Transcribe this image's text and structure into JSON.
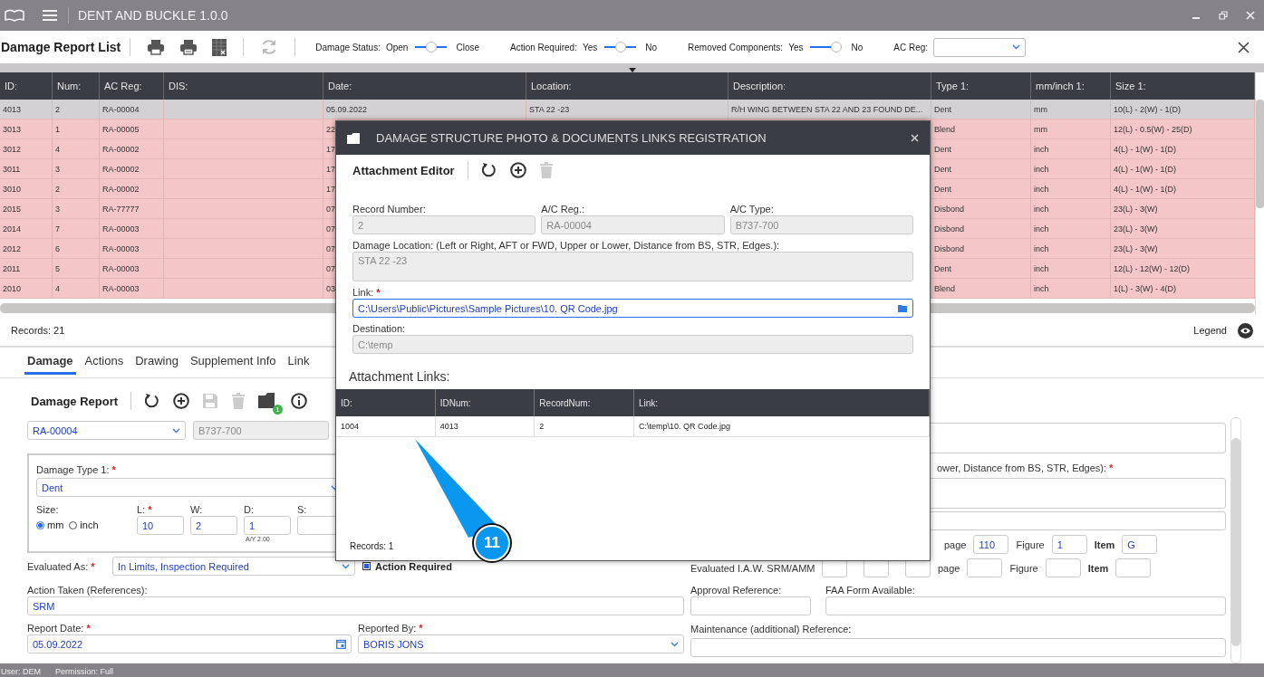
{
  "window": {
    "title": "DENT AND BUCKLE 1.0.0"
  },
  "toolbar": {
    "title": "Damage Report List",
    "filters": [
      {
        "label": "Damage Status:",
        "left": "Open",
        "right": "Close",
        "level": 0.5
      },
      {
        "label": "Action Required:",
        "left": "Yes",
        "right": "No",
        "level": 0.5
      },
      {
        "label": "Removed Components:",
        "left": "Yes",
        "right": "No",
        "level": 1
      }
    ],
    "ac_reg": {
      "label": "AC Reg:"
    }
  },
  "table": {
    "columns": [
      "ID:",
      "Num:",
      "AC Reg:",
      "DIS:",
      "Date:",
      "Location:",
      "Description:",
      "Type 1:",
      "mm/inch 1:",
      "Size 1:"
    ],
    "rows": [
      {
        "selected": true,
        "cells": [
          "4013",
          "2",
          "RA-00004",
          null,
          "05.09.2022",
          "STA 22 -23",
          "R/H WING BETWEEN STA 22 AND 23 FOUND DE...",
          "Dent",
          "mm",
          "10(L) - 2(W) - 1(D)"
        ]
      },
      {
        "selected": false,
        "cells": [
          "3013",
          "1",
          "RA-00005",
          null,
          "22",
          null,
          null,
          "Blend",
          "mm",
          "12(L) - 0.5(W) - 25(D)"
        ]
      },
      {
        "selected": false,
        "cells": [
          "3012",
          "4",
          "RA-00002",
          null,
          "17",
          null,
          null,
          "Dent",
          "inch",
          "4(L) - 1(W) - 1(D)"
        ]
      },
      {
        "selected": false,
        "cells": [
          "3011",
          "3",
          "RA-00002",
          null,
          "17",
          null,
          null,
          "Dent",
          "inch",
          "4(L) - 1(W) - 1(D)"
        ]
      },
      {
        "selected": false,
        "cells": [
          "3010",
          "2",
          "RA-00002",
          null,
          "17",
          null,
          null,
          "Dent",
          "inch",
          "4(L) - 1(W) - 1(D)"
        ]
      },
      {
        "selected": false,
        "cells": [
          "2015",
          "3",
          "RA-77777",
          null,
          "07",
          null,
          null,
          "Disbond",
          "inch",
          "23(L) - 3(W)"
        ]
      },
      {
        "selected": false,
        "cells": [
          "2014",
          "7",
          "RA-00003",
          null,
          "07",
          null,
          null,
          "Disbond",
          "inch",
          "23(L) - 3(W)"
        ]
      },
      {
        "selected": false,
        "cells": [
          "2012",
          "6",
          "RA-00003",
          null,
          "07",
          null,
          null,
          "Disbond",
          "inch",
          "23(L) - 3(W)"
        ]
      },
      {
        "selected": false,
        "cells": [
          "2011",
          "5",
          "RA-00003",
          null,
          "07",
          null,
          null,
          "Dent",
          "inch",
          "12(L) - 12(W) - 12(D)"
        ]
      },
      {
        "selected": false,
        "cells": [
          "2010",
          "4",
          "RA-00003",
          null,
          "03",
          null,
          null,
          "Blend",
          "inch",
          "1(L) - 3(W) - 4(D)"
        ]
      }
    ]
  },
  "records": "Records: 21",
  "legend": "Legend",
  "tabs": [
    {
      "label": "Damage",
      "selected": true
    },
    {
      "label": "Actions",
      "selected": false
    },
    {
      "label": "Drawing",
      "selected": false
    },
    {
      "label": "Supplement Info",
      "selected": false
    },
    {
      "label": "Link",
      "selected": false
    }
  ],
  "form": {
    "title": "Damage Report",
    "attachment_count": "1",
    "ac_reg": {
      "value": "RA-00004"
    },
    "ac_type": {
      "value": "B737-700",
      "disabled": true
    },
    "damage_type": {
      "label": "Damage Type 1:",
      "mark": "*",
      "value": "Dent"
    },
    "size": {
      "label": "Size:",
      "options": [
        {
          "label": "mm",
          "selected": true
        },
        {
          "label": "inch",
          "selected": false
        }
      ]
    },
    "dims": [
      {
        "label": "L:",
        "mark": "*",
        "value": "10"
      },
      {
        "label": "W:",
        "value": "2"
      },
      {
        "label": "D:",
        "value": "1",
        "note": "A/Y 2.00"
      },
      {
        "label": "S:"
      }
    ],
    "evaluated_as": {
      "label": "Evaluated As:",
      "mark": "*",
      "value": "In Limits, Inspection Required"
    },
    "action_required": {
      "label": "Action Required",
      "checked": true
    },
    "action_taken": {
      "label": "Action Taken (References):",
      "value": "SRM"
    },
    "report_date": {
      "label": "Report Date:",
      "mark": "*",
      "value": "05.09.2022"
    },
    "reported_by": {
      "label": "Reported By:",
      "mark": "*",
      "value": "BORIS JONS"
    },
    "location": {
      "label": "ower, Distance from BS, STR, Edges):",
      "mark": "*"
    },
    "ref_rows": [
      {
        "page": "page",
        "page_value": "110",
        "figure": "Figure",
        "figure_value": "1",
        "item": "Item",
        "item_value": "G"
      },
      {
        "label": "Evaluated I.A.W. SRM/AMM",
        "page": "page",
        "figure": "Figure",
        "item": "Item"
      }
    ],
    "approval": {
      "label": "Approval Reference:"
    },
    "faa": {
      "label": "FAA Form Available:"
    },
    "maintenance": {
      "label": "Maintenance (additional) Reference:"
    }
  },
  "dialog": {
    "title": "DAMAGE STRUCTURE PHOTO & DOCUMENTS LINKS REGISTRATION",
    "editor_title": "Attachment Editor",
    "fields": [
      {
        "label": "Record Number:",
        "value": "2",
        "disabled": true
      },
      {
        "label": "A/C Reg.:",
        "value": "RA-00004",
        "disabled": true
      },
      {
        "label": "A/C Type:",
        "value": "B737-700",
        "disabled": true
      }
    ],
    "location": {
      "label": "Damage Location: (Left or Right, AFT or FWD, Upper or Lower, Distance from BS, STR, Edges.):",
      "value": "STA 22 -23",
      "disabled": true
    },
    "link": {
      "label": "Link:",
      "mark": "*",
      "value": "C:\\Users\\Public\\Pictures\\Sample Pictures\\10. QR Code.jpg",
      "disabled": false
    },
    "destination": {
      "label": "Destination:",
      "value": "C:\\temp",
      "disabled": true
    },
    "links_title": "Attachment Links:",
    "links": {
      "columns": [
        "ID:",
        "IDNum:",
        "RecordNum:",
        "Link:"
      ],
      "rows": [
        [
          "1004",
          "4013",
          "2",
          "C:\\temp\\10. QR Code.jpg"
        ]
      ]
    },
    "records": "Records: 1"
  },
  "callout": {
    "label": "11"
  },
  "status_bar": {
    "user": "User: DEM",
    "permission": "Permission: Full"
  }
}
